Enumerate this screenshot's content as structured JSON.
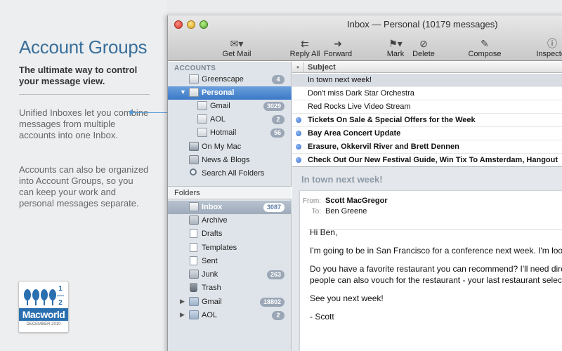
{
  "promo": {
    "title": "Account Groups",
    "subtitle": "The ultimate way to control your message view.",
    "paragraph1": "Unified Inboxes let you combine messages from multiple accounts into one Inbox.",
    "paragraph2": "Accounts can also be organized into Account Groups, so you can keep your work and personal messages separate.",
    "badge": {
      "name": "Macworld",
      "rating_fraction": "1\n2",
      "date": "DECEMBER 2010",
      "rating_mice": 4.5
    }
  },
  "window": {
    "title": "Inbox — Personal (10179 messages)",
    "toolbar": [
      {
        "label": "Get Mail",
        "icon": "envelope-icon"
      },
      {
        "label": "Reply All",
        "icon": "reply-all-icon"
      },
      {
        "label": "Forward",
        "icon": "forward-icon"
      },
      {
        "label": "Mark",
        "icon": "mark-icon"
      },
      {
        "label": "Delete",
        "icon": "delete-icon"
      },
      {
        "label": "Compose",
        "icon": "pencil-icon"
      },
      {
        "label": "Inspector",
        "icon": "inspector-icon"
      }
    ]
  },
  "sidebar": {
    "accounts_header": "ACCOUNTS",
    "accounts": [
      {
        "label": "Greenscape",
        "count": "4"
      },
      {
        "label": "Personal",
        "count": ""
      },
      {
        "label": "Gmail",
        "count": "3029"
      },
      {
        "label": "AOL",
        "count": "2"
      },
      {
        "label": "Hotmail",
        "count": "56"
      },
      {
        "label": "On My Mac",
        "count": ""
      },
      {
        "label": "News & Blogs",
        "count": ""
      },
      {
        "label": "Search All Folders",
        "count": ""
      }
    ],
    "folders_header": "Folders",
    "folders": [
      {
        "label": "Inbox",
        "count": "3087"
      },
      {
        "label": "Archive",
        "count": ""
      },
      {
        "label": "Drafts",
        "count": ""
      },
      {
        "label": "Templates",
        "count": ""
      },
      {
        "label": "Sent",
        "count": ""
      },
      {
        "label": "Junk",
        "count": "263"
      },
      {
        "label": "Trash",
        "count": ""
      },
      {
        "label": "Gmail",
        "count": "18802"
      },
      {
        "label": "AOL",
        "count": "2"
      }
    ]
  },
  "list": {
    "column_subject": "Subject",
    "messages": [
      {
        "subject": "In town next week!",
        "unread": false
      },
      {
        "subject": "Don't miss Dark Star Orchestra",
        "unread": false
      },
      {
        "subject": "Red Rocks Live Video Stream",
        "unread": false
      },
      {
        "subject": "Tickets On Sale & Special Offers for the Week",
        "unread": true
      },
      {
        "subject": "Bay Area Concert Update",
        "unread": true
      },
      {
        "subject": "Erasure, Okkervil River and Brett Dennen",
        "unread": true
      },
      {
        "subject": "Check Out Our New Festival Guide, Win Tix To Amsterdam, Hangout",
        "unread": true
      }
    ]
  },
  "preview": {
    "title": "In town next week!",
    "from_label": "From:",
    "from": "Scott MacGregor",
    "to_label": "To:",
    "to": "Ben Greene",
    "body": [
      "Hi Ben,",
      "I'm going to be in San Francisco for a conference next week. I'm looking",
      "Do you have a favorite restaurant you can recommend? I'll need directi",
      "people can also vouch for the restaurant - your last restaurant selection",
      "See you next week!",
      "- Scott"
    ]
  }
}
